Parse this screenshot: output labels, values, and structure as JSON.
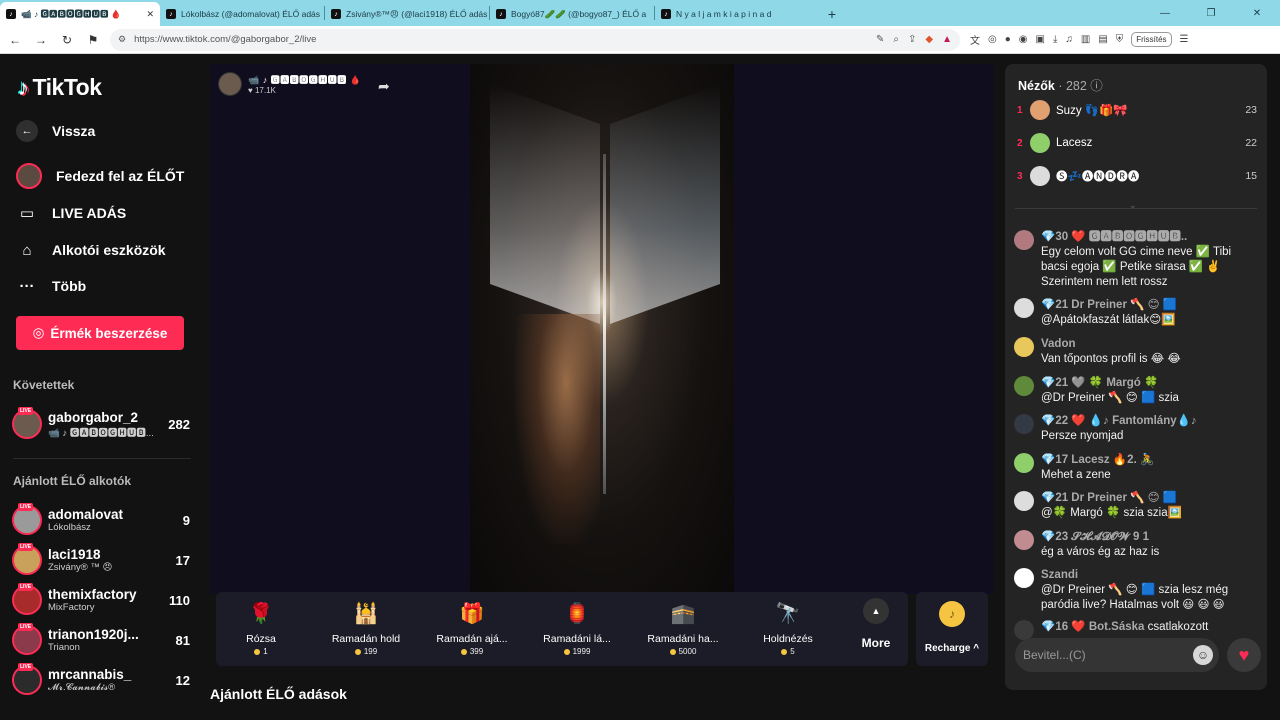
{
  "browser": {
    "tabs": [
      {
        "label": "📹 ♪ 🅶🅰🅱🅾🅶🅷🆄🅱 🩸",
        "active": true
      },
      {
        "label": "Lókolbász (@adomalovat) ÉLŐ adás"
      },
      {
        "label": "Zsivány®™😠 (@laci1918) ÉLŐ adás"
      },
      {
        "label": "Bogyó87🥒🥒 (@bogyo87_) ÉLŐ a"
      },
      {
        "label": "N y a l j a m k i a p i n a d"
      }
    ],
    "new_tab": "+",
    "url": "https://www.tiktok.com/@gaborgabor_2/live",
    "refresh_label": "Frissítés",
    "window_controls": [
      "—",
      "❐",
      "✕"
    ]
  },
  "sidebar": {
    "logo": "TikTok",
    "back": "Vissza",
    "explore": "Fedezd fel az ÉLŐT",
    "live": "LIVE ADÁS",
    "creator_tools": "Alkotói eszközök",
    "more": "Több",
    "coins_button": "Érmék beszerzése",
    "followed_title": "Követettek",
    "followed": [
      {
        "name": "gaborgabor_2",
        "sub": "📹 ♪ 🅶🅰🅱🅾🅶🅷🆄🅱...",
        "count": "282"
      }
    ],
    "recommended_title": "Ajánlott ÉLŐ alkotók",
    "recommended": [
      {
        "name": "adomalovat",
        "sub": "Lókolbász",
        "count": "9"
      },
      {
        "name": "laci1918",
        "sub": "Zsivány® ™ 😠",
        "count": "17"
      },
      {
        "name": "themixfactory",
        "sub": "MixFactory",
        "count": "110"
      },
      {
        "name": "trianon1920j...",
        "sub": "Trianon",
        "count": "81"
      },
      {
        "name": "mrcannabis_",
        "sub": "𝓜𝓻.𝓒𝓪𝓷𝓷𝓪𝓫𝓲𝓼®",
        "count": "12"
      }
    ],
    "live_tag": "LIVE"
  },
  "stream": {
    "host_name": "📹 ♪ 🅶🅰🅱🅾🅶🅷🆄🅱 🩸",
    "host_likes": "♥ 17.1K"
  },
  "gifts": [
    {
      "name": "Rózsa",
      "price": "1",
      "icon": "🌹"
    },
    {
      "name": "Ramadán hold",
      "price": "199",
      "icon": "🕌"
    },
    {
      "name": "Ramadán ajá...",
      "price": "399",
      "icon": "🎁"
    },
    {
      "name": "Ramadáni lá...",
      "price": "1999",
      "icon": "🏮"
    },
    {
      "name": "Ramadáni ha...",
      "price": "5000",
      "icon": "🕋"
    },
    {
      "name": "Holdnézés",
      "price": "5",
      "icon": "🔭"
    }
  ],
  "more_label": "More",
  "recharge_label": "Recharge ^",
  "recommended_streams_title": "Ajánlott ÉLŐ adások",
  "panel": {
    "viewers_label": "Nézők",
    "viewers_count": "· 282",
    "top_viewers": [
      {
        "rank": "1",
        "name": "Suzy 👣🎁🎀",
        "score": "23",
        "color": "#e0a070"
      },
      {
        "rank": "2",
        "name": "Lacesz",
        "score": "22",
        "color": "#8fcf6a"
      },
      {
        "rank": "3",
        "name": "🅢💤🅐🅝🅓🅡🅐",
        "score": "15",
        "color": "#dcdcdc"
      }
    ],
    "messages": [
      {
        "user": "💎30 ❤️ 🅶🅰🅱🅾🅶🅷🆄🅱..",
        "text": "Egy celom volt GG cime neve ✅ Tibi bacsi egoja ✅ Petike sirasa ✅ ✌️ Szerintem nem lett rossz",
        "color": "#b07a80"
      },
      {
        "user": "💎21 Dr Preiner 🪓 😊 🟦",
        "text": "@Apátokfaszát látlak😊🖼️",
        "color": "#dddddd"
      },
      {
        "user": "Vadon",
        "text": "Van tőpontos profil is 😂 😂",
        "color": "#e8c85a"
      },
      {
        "user": "💎21 🩶 🍀 Margó 🍀",
        "text": "@Dr Preiner 🪓 😊 🟦 szia",
        "color": "#5e8a3a"
      },
      {
        "user": "💎22 ❤️ 💧♪ Fantomlány💧♪",
        "text": "Persze nyomjad",
        "color": "#333a44"
      },
      {
        "user": "💎17 Lacesz 🔥2. 🚴",
        "text": "Mehet a zene",
        "color": "#8fcf6a"
      },
      {
        "user": "💎21 Dr Preiner 🪓 😊 🟦",
        "text": "@🍀 Margó 🍀 szia szia🖼️",
        "color": "#dddddd"
      },
      {
        "user": "💎23 𝓢𝓗𝓐𝓓𝓞𝓦 9 1",
        "text": "ég a város ég az haz is",
        "color": "#c08c90"
      },
      {
        "user": "Szandi",
        "text": "@Dr Preiner 🪓 😊 🟦 szia lesz még paródia live? Hatalmas volt 😃 😃 😃",
        "color": "#ffffff"
      },
      {
        "user": "💎16 ❤️ Bot.Sáska",
        "text": "csatlakozott",
        "color": "#3a3a3a"
      }
    ],
    "input_placeholder": "Bevitel...(C)"
  }
}
